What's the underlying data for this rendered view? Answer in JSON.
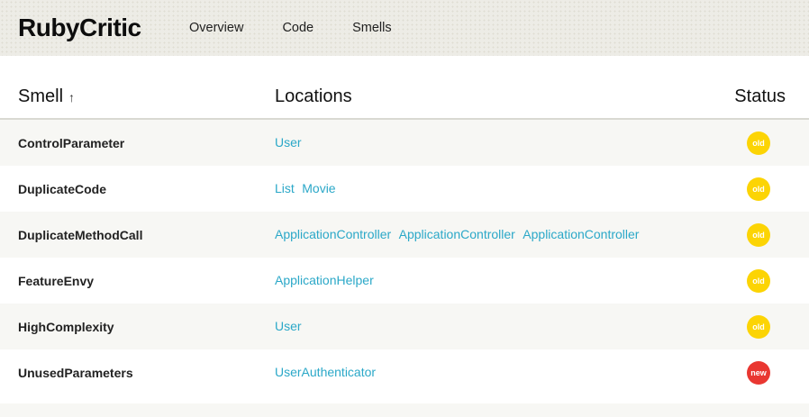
{
  "brand": {
    "title": "RubyCritic"
  },
  "nav": {
    "items": [
      {
        "label": "Overview"
      },
      {
        "label": "Code"
      },
      {
        "label": "Smells"
      }
    ]
  },
  "table": {
    "headers": {
      "smell": "Smell",
      "sort_arrow": "↑",
      "locations": "Locations",
      "status": "Status"
    },
    "rows": [
      {
        "smell": "ControlParameter",
        "locations": [
          "User"
        ],
        "status": "old"
      },
      {
        "smell": "DuplicateCode",
        "locations": [
          "List",
          "Movie"
        ],
        "status": "old"
      },
      {
        "smell": "DuplicateMethodCall",
        "locations": [
          "ApplicationController",
          "ApplicationController",
          "ApplicationController"
        ],
        "status": "old"
      },
      {
        "smell": "FeatureEnvy",
        "locations": [
          "ApplicationHelper"
        ],
        "status": "old"
      },
      {
        "smell": "HighComplexity",
        "locations": [
          "User"
        ],
        "status": "old"
      },
      {
        "smell": "UnusedParameters",
        "locations": [
          "UserAuthenticator"
        ],
        "status": "new"
      }
    ]
  },
  "colors": {
    "badge_old": "#FCD404",
    "badge_new": "#E93731",
    "link": "#2BA8C8",
    "header_bg": "#EDECE6"
  }
}
